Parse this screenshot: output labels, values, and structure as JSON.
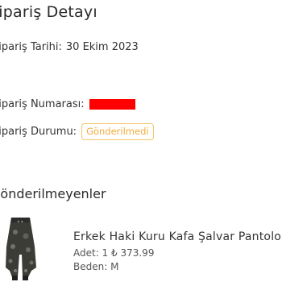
{
  "order": {
    "title": "Sipariş Detayı",
    "date_label": "Sipariş Tarihi:",
    "date_value": "30 Ekim 2023",
    "number_label": "Sipariş Numarası:",
    "status_label": "Sipariş Durumu:",
    "status_value": "Gönderilmedi",
    "status_color": "#f0ad3c",
    "redaction_color": "#ff0000"
  },
  "section": {
    "title": "Gönderilmeyenler"
  },
  "product": {
    "name": "Erkek Haki Kuru Kafa Şalvar Pantolon",
    "quantity_price": "Adet: 1 ₺ 373.99",
    "size": "Beden: M"
  }
}
